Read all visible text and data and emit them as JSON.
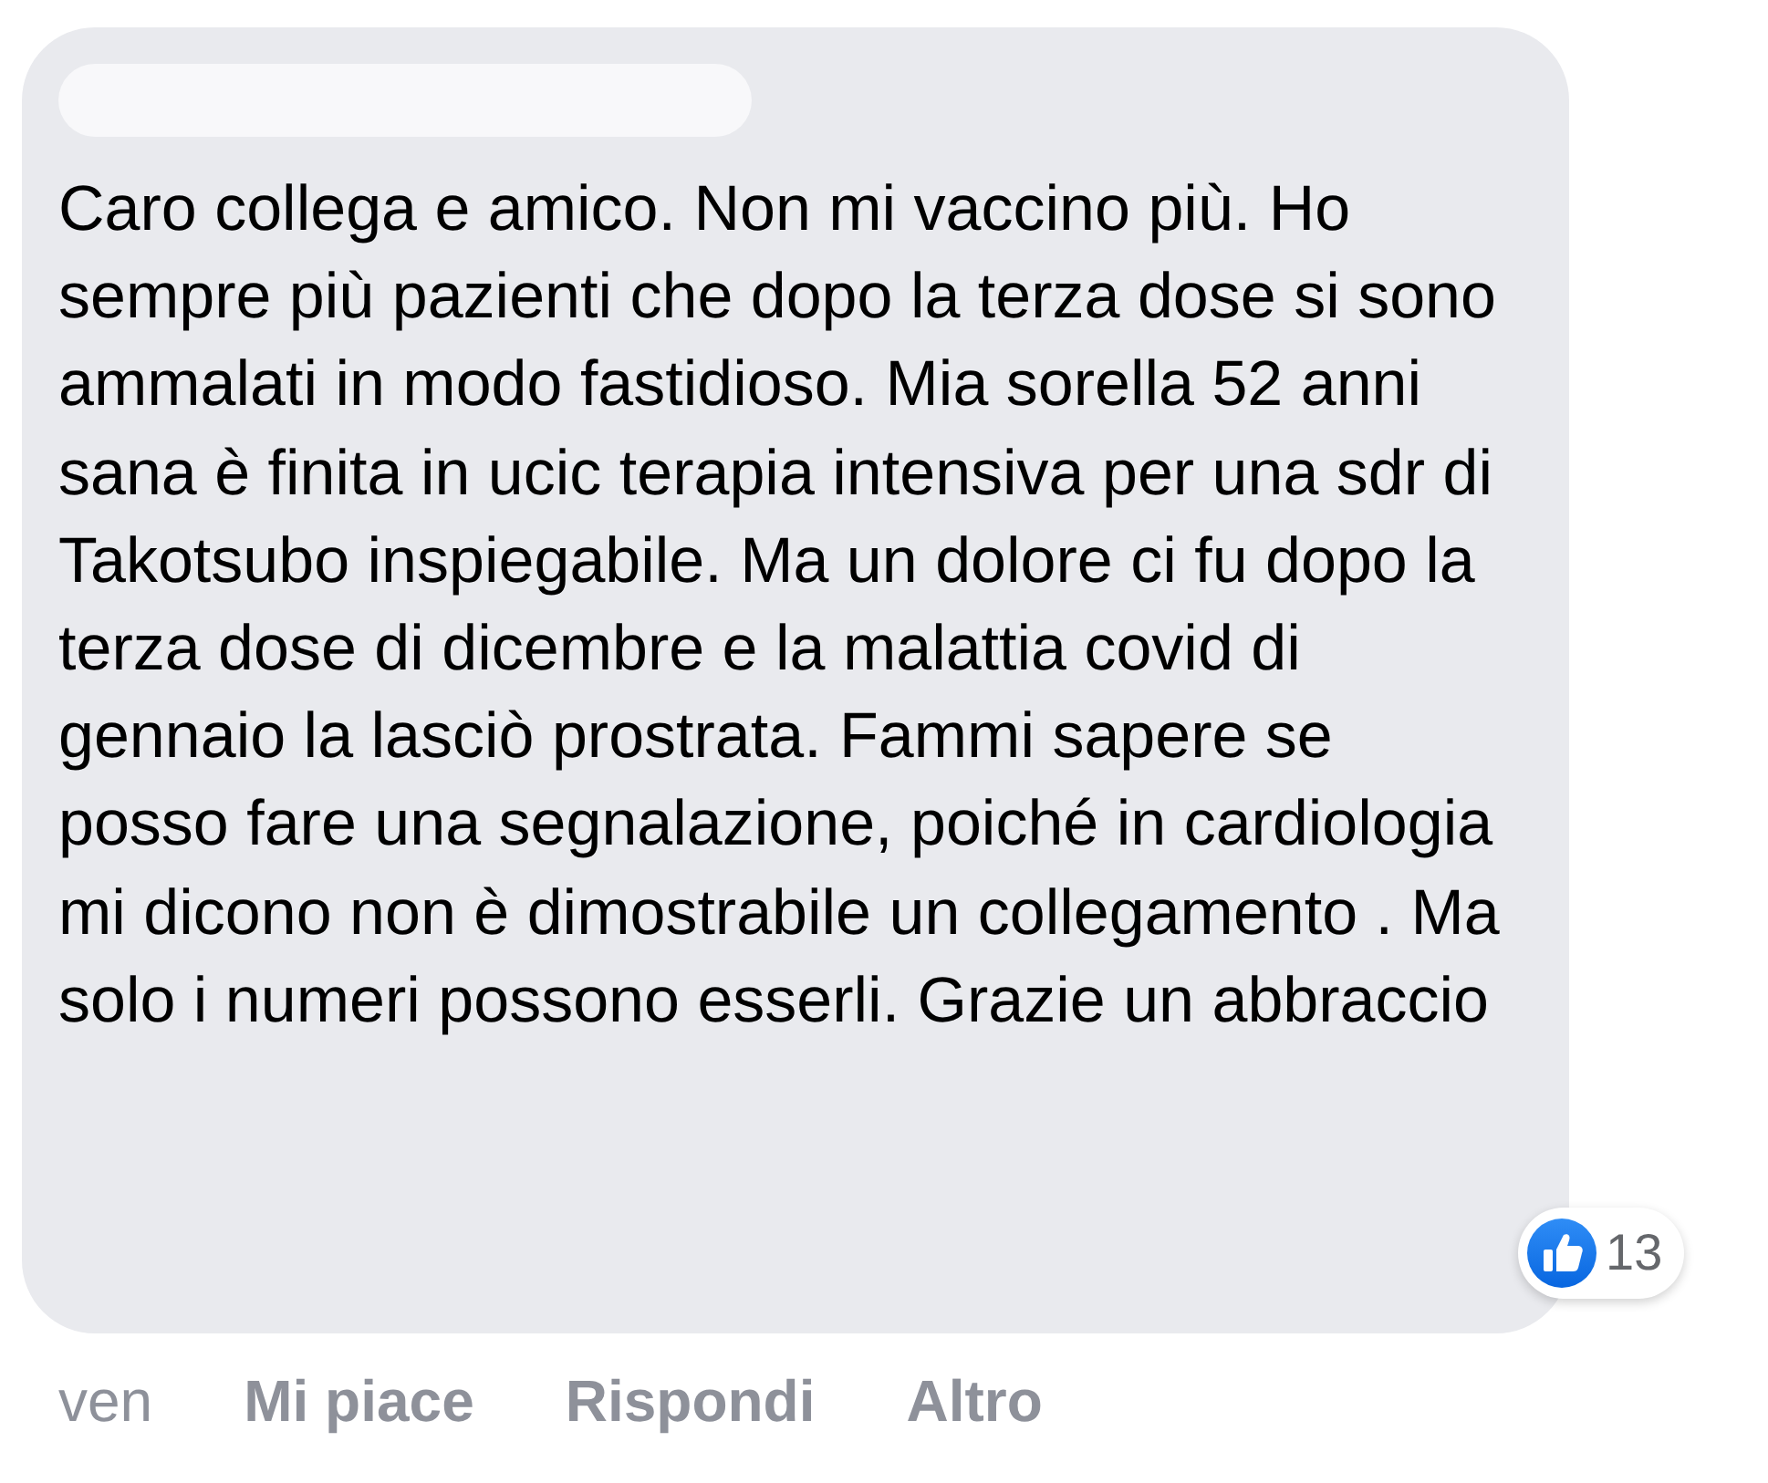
{
  "comment": {
    "text": "Caro collega e amico. Non mi vaccino più. Ho sempre più pazienti che dopo la terza dose si sono ammalati in modo fastidioso. Mia sorella 52 anni sana è finita in ucic terapia intensiva per una sdr di Takotsubo inspiegabile. Ma un dolore ci fu dopo la terza dose di dicembre e la malattia covid di gennaio la lasciò prostrata. Fammi sapere se posso fare una segnalazione, poiché in cardiologia mi dicono non è dimostrabile un collegamento . Ma solo i numeri possono esserli. Grazie un abbraccio",
    "reactions": {
      "count": "13"
    }
  },
  "footer": {
    "time": "ven",
    "actions": [
      {
        "label": "Mi piace"
      },
      {
        "label": "Rispondi"
      },
      {
        "label": "Altro"
      }
    ]
  }
}
